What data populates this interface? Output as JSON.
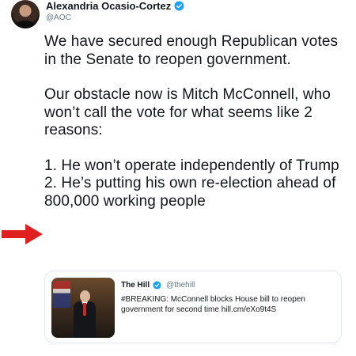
{
  "author": {
    "display_name": "Alexandria Ocasio-Cortez",
    "handle": "@AOC"
  },
  "tweet": {
    "paragraphs": [
      "We have secured enough Republican votes in the Senate to reopen government.",
      "Our obstacle now is Mitch McConnell, who won’t call the vote for what seems like 2 reasons:",
      "1. He won’t operate independently of Trump",
      "2. He’s putting his own re-election ahead of 800,000 working people"
    ]
  },
  "quoted_tweet": {
    "display_name": "The Hill",
    "handle": "@thehill",
    "text": "#BREAKING: McConnell blocks House bill to reopen government for second time hill.cm/eXo9t4S"
  },
  "colors": {
    "verified": "#1da1f2",
    "arrow": "#e02020",
    "secondary_text": "#657786"
  },
  "icons": {
    "verified": "verified-badge-icon",
    "arrow": "red-arrow-annotation"
  }
}
